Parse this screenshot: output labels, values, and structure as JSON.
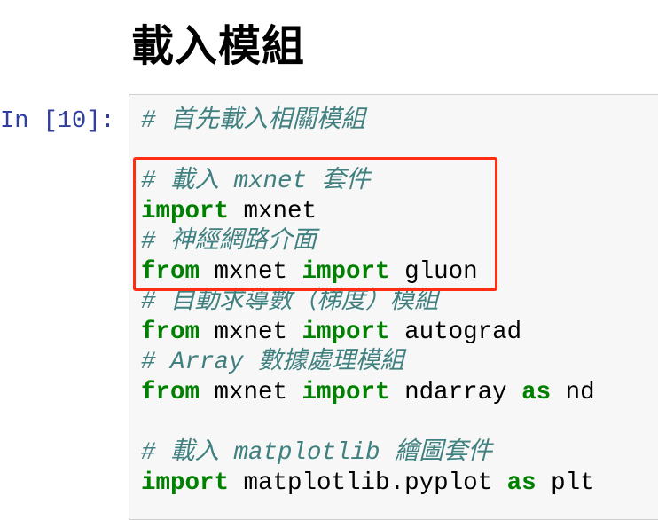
{
  "heading": "載入模組",
  "cell": {
    "prompt": "In [10]:",
    "lines": [
      [
        {
          "t": "c",
          "text": "# 首先載入相關模組"
        }
      ],
      [],
      [
        {
          "t": "c",
          "text": "# 載入 mxnet 套件"
        }
      ],
      [
        {
          "t": "k",
          "text": "import"
        },
        {
          "t": "n",
          "text": " mxnet"
        }
      ],
      [
        {
          "t": "c",
          "text": "# 神經網路介面"
        }
      ],
      [
        {
          "t": "k",
          "text": "from"
        },
        {
          "t": "n",
          "text": " mxnet "
        },
        {
          "t": "k",
          "text": "import"
        },
        {
          "t": "n",
          "text": " gluon"
        }
      ],
      [
        {
          "t": "c",
          "text": "# 自動求導數（梯度）模組"
        }
      ],
      [
        {
          "t": "k",
          "text": "from"
        },
        {
          "t": "n",
          "text": " mxnet "
        },
        {
          "t": "k",
          "text": "import"
        },
        {
          "t": "n",
          "text": " autograd"
        }
      ],
      [
        {
          "t": "c",
          "text": "# Array 數據處理模組"
        }
      ],
      [
        {
          "t": "k",
          "text": "from"
        },
        {
          "t": "n",
          "text": " mxnet "
        },
        {
          "t": "k",
          "text": "import"
        },
        {
          "t": "n",
          "text": " ndarray "
        },
        {
          "t": "k",
          "text": "as"
        },
        {
          "t": "n",
          "text": " nd"
        }
      ],
      [],
      [
        {
          "t": "c",
          "text": "# 載入 matplotlib 繪圖套件"
        }
      ],
      [
        {
          "t": "k",
          "text": "import"
        },
        {
          "t": "n",
          "text": " matplotlib.pyplot "
        },
        {
          "t": "k",
          "text": "as"
        },
        {
          "t": "n",
          "text": " plt"
        }
      ]
    ]
  },
  "colors": {
    "comment": "#408080",
    "keyword": "#008000",
    "prompt": "#303f9f",
    "highlight": "#ff2d12"
  }
}
